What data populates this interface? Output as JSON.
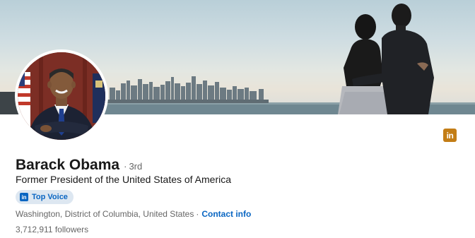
{
  "profile": {
    "name": "Barack Obama",
    "degree": "3rd",
    "headline": "Former President of the United States of America",
    "badge_label": "Top Voice",
    "badge_icon_text": "in",
    "location": "Washington, District of Columbia, United States",
    "contact_label": "Contact info",
    "followers": "3,712,911 followers"
  },
  "brand": {
    "linkedin_icon_text": "in",
    "accent_blue": "#0a66c2",
    "badge_bg": "#dde7f1",
    "linkedin_gold": "#c37d16"
  },
  "icons": [
    "linkedin-icon",
    "top-voice-icon"
  ]
}
